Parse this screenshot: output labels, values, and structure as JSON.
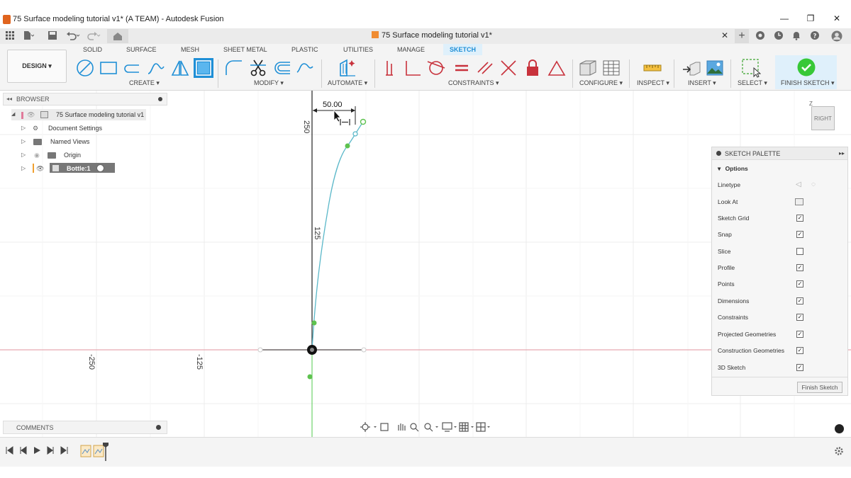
{
  "window": {
    "title": "75 Surface modeling tutorial v1* (A TEAM) - Autodesk Fusion",
    "minimize": "—",
    "maximize": "❐",
    "close": "✕"
  },
  "document_tab": {
    "title": "75 Surface modeling tutorial v1*",
    "close": "✕"
  },
  "workspace": {
    "label": "DESIGN ▾"
  },
  "tabs": [
    {
      "label": "SOLID"
    },
    {
      "label": "SURFACE"
    },
    {
      "label": "MESH"
    },
    {
      "label": "SHEET METAL"
    },
    {
      "label": "PLASTIC"
    },
    {
      "label": "UTILITIES"
    },
    {
      "label": "MANAGE"
    },
    {
      "label": "SKETCH"
    }
  ],
  "active_tab": "SKETCH",
  "groups": {
    "create": "CREATE ▾",
    "modify": "MODIFY ▾",
    "automate": "AUTOMATE ▾",
    "constraints": "CONSTRAINTS ▾",
    "configure": "CONFIGURE ▾",
    "inspect": "INSPECT ▾",
    "insert": "INSERT ▾",
    "select": "SELECT ▾",
    "finish": "FINISH SKETCH ▾"
  },
  "browser": {
    "title": "BROWSER",
    "root": "75 Surface modeling tutorial v1",
    "items": [
      {
        "label": "Document Settings"
      },
      {
        "label": "Named Views"
      },
      {
        "label": "Origin"
      },
      {
        "label": "Bottle:1"
      }
    ]
  },
  "comments": {
    "title": "COMMENTS"
  },
  "sketch": {
    "dimension_horizontal": "50.00",
    "axis_labels": {
      "v_250": "250",
      "v_125": "125",
      "h_neg250": "-250",
      "h_neg125": "-125"
    },
    "viewcube_label": "RIGHT",
    "viewcube_axis": "Z"
  },
  "palette": {
    "title": "SKETCH PALETTE",
    "section": "Options",
    "rows": [
      {
        "label": "Linetype",
        "type": "icons"
      },
      {
        "label": "Look At",
        "type": "icon"
      },
      {
        "label": "Sketch Grid",
        "checked": true
      },
      {
        "label": "Snap",
        "checked": true
      },
      {
        "label": "Slice",
        "checked": false
      },
      {
        "label": "Profile",
        "checked": true
      },
      {
        "label": "Points",
        "checked": true
      },
      {
        "label": "Dimensions",
        "checked": true
      },
      {
        "label": "Constraints",
        "checked": true
      },
      {
        "label": "Projected Geometries",
        "checked": true
      },
      {
        "label": "Construction Geometries",
        "checked": true
      },
      {
        "label": "3D Sketch",
        "checked": true
      }
    ],
    "finish_button": "Finish Sketch"
  },
  "colors": {
    "accent": "#1f8fd6",
    "curve": "#5bb8c9",
    "point_green": "#5ec24f",
    "constraint_red": "#c8323c",
    "finish_green": "#37c837"
  }
}
